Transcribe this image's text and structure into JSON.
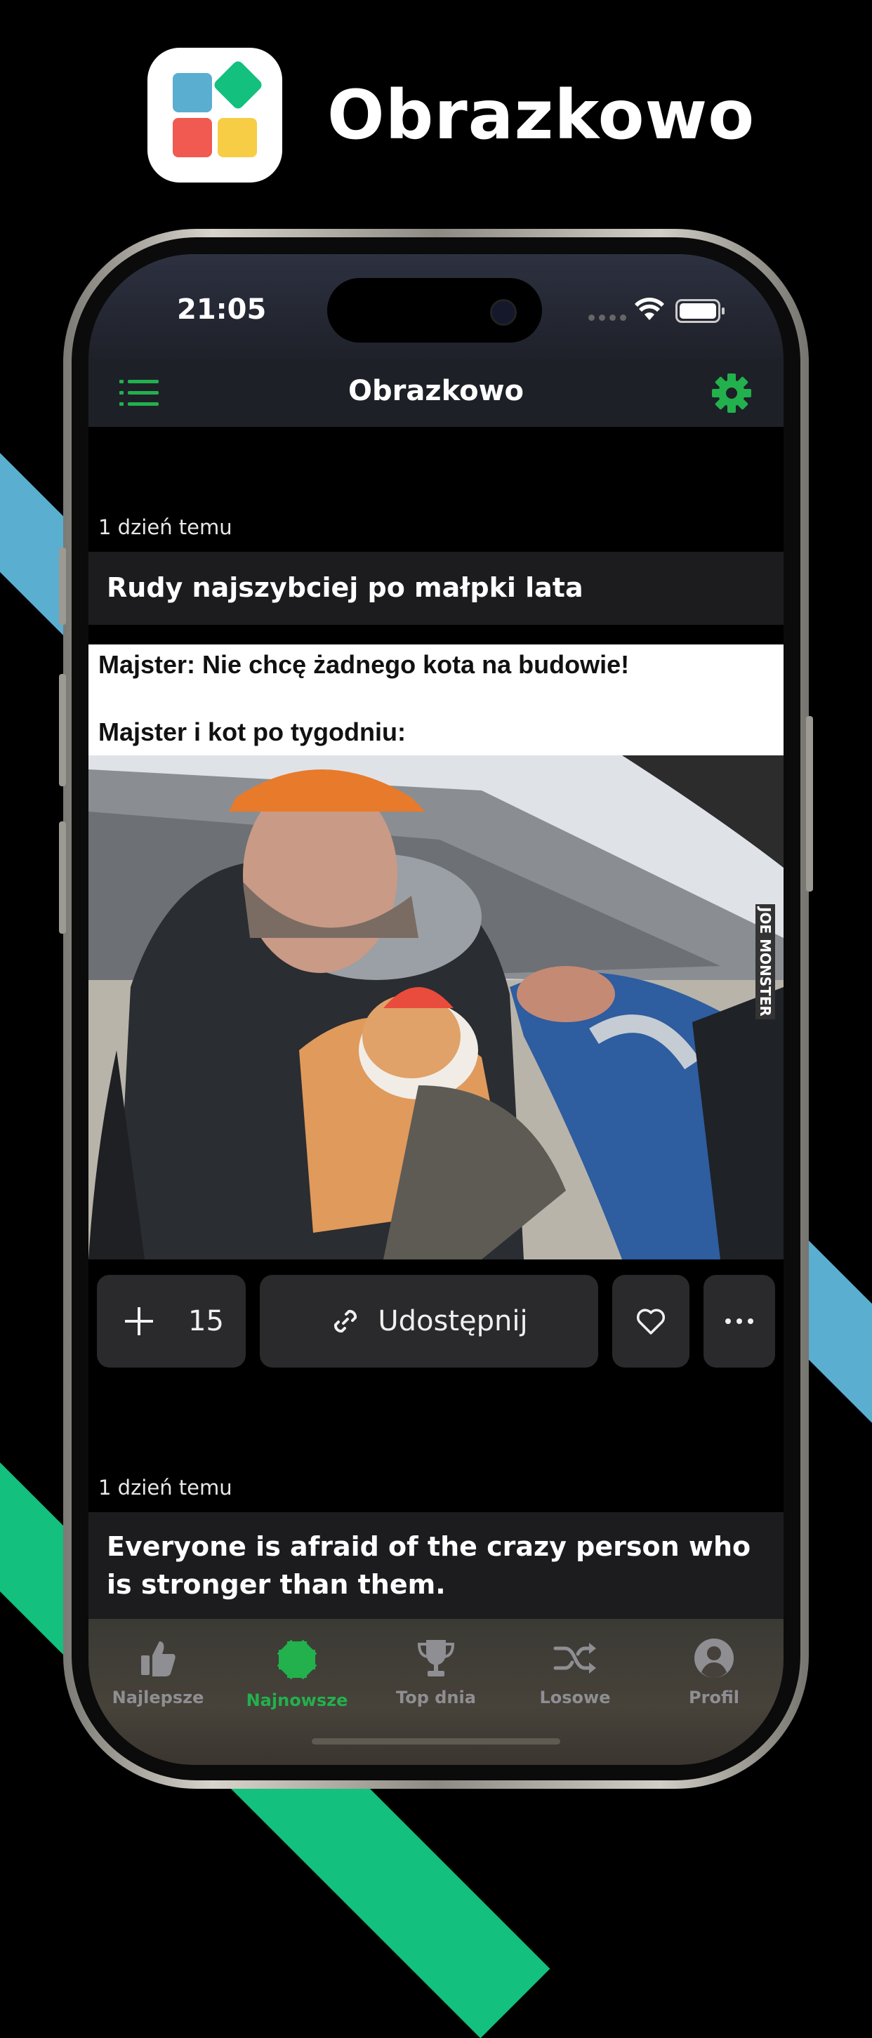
{
  "brand": {
    "app_name": "Obrazkowo",
    "colors": {
      "blue": "#5aaed0",
      "green": "#13c07d",
      "red": "#f15a50",
      "yellow": "#f7cd45"
    }
  },
  "status_bar": {
    "time": "21:05",
    "icons": [
      "wifi-icon",
      "battery-icon"
    ]
  },
  "nav": {
    "title": "Obrazkowo",
    "left_icon": "menu-list-icon",
    "right_icon": "gear-icon",
    "accent": "#22b14c"
  },
  "posts": [
    {
      "timestamp": "1 dzień temu",
      "title": "Rudy najszybciej po małpki lata",
      "image_caption_1": "Majster: Nie chcę żadnego kota na budowie!",
      "image_caption_2": "Majster i kot po tygodniu:",
      "watermark": "JOE MONSTER",
      "plus_count": "15",
      "share_label": "Udostępnij"
    },
    {
      "timestamp": "1 dzień temu",
      "title": "Everyone is afraid of the crazy person who is stronger than them."
    }
  ],
  "tabs": [
    {
      "label": "Najlepsze",
      "icon": "thumbs-up-icon",
      "active": false
    },
    {
      "label": "Najnowsze",
      "icon": "badge-icon",
      "active": true
    },
    {
      "label": "Top dnia",
      "icon": "trophy-icon",
      "active": false
    },
    {
      "label": "Losowe",
      "icon": "shuffle-icon",
      "active": false
    },
    {
      "label": "Profil",
      "icon": "profile-icon",
      "active": false
    }
  ]
}
